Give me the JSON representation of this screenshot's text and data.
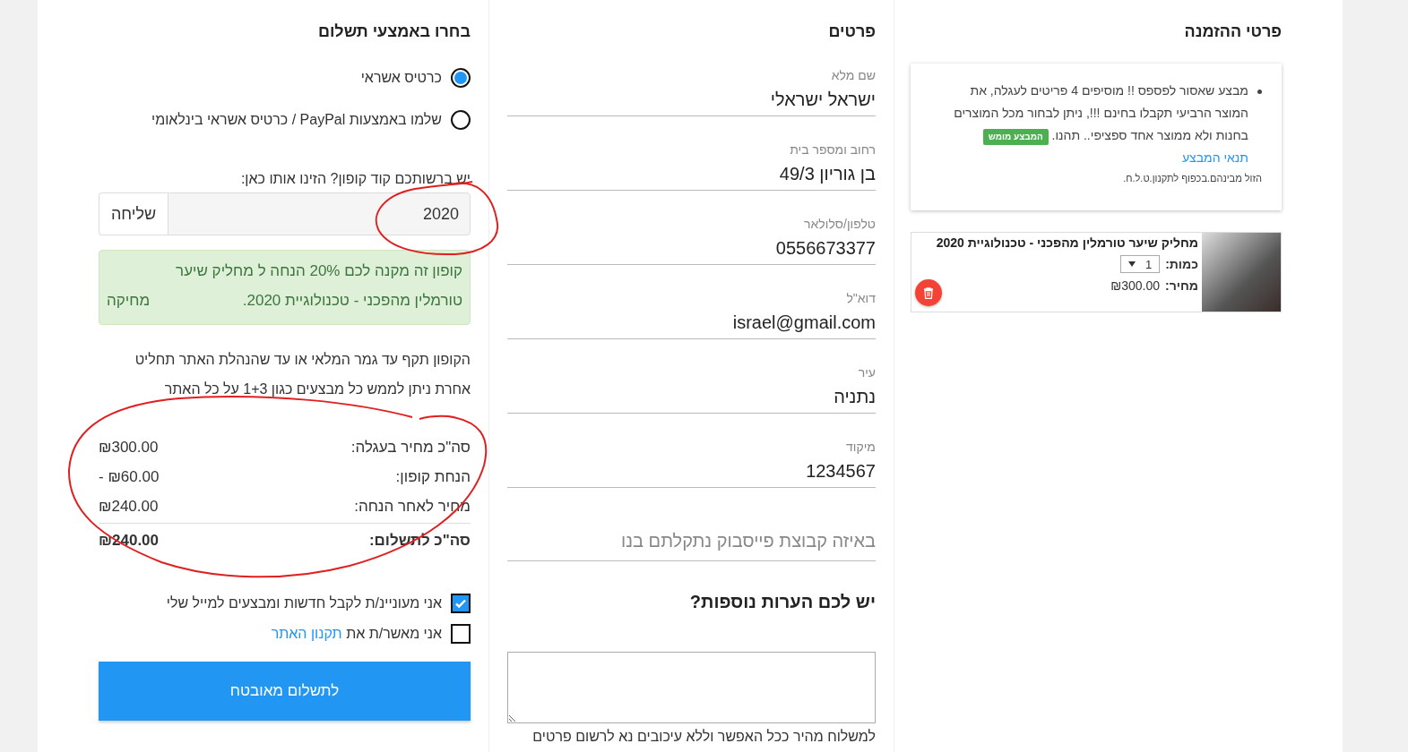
{
  "order_details": {
    "title": "פרטי ההזמנה",
    "promo": {
      "text": "מבצע שאסור לפספס !! מוסיפים 4 פריטים לעגלה, את המוצר הרביעי תקבלו בחינם !!!, ניתן לבחור מכל המוצרים בחנות ולא ממוצר אחד ספציפי.. תהנו.",
      "badge": "המבצע מומש",
      "link": "תנאי המבצע",
      "note": "הזול מבינהם.בכפוף לתקנון.ט.ל.ח."
    },
    "cart_items": [
      {
        "name": "מחליק שיער טורמלין מהפכני - טכנולוגיית 2020",
        "quantity_label": "כמות:",
        "quantity": "1",
        "price_label": "מחיר:",
        "price": "₪300.00"
      }
    ]
  },
  "details": {
    "title": "פרטים",
    "fields": [
      {
        "label": "שם מלא",
        "value": "ישראל ישראלי"
      },
      {
        "label": "רחוב ומספר בית",
        "value": "בן גוריון 49/3"
      },
      {
        "label": "טלפון/סלולאר",
        "value": "0556673377"
      },
      {
        "label": "דוא\"ל",
        "value": "israel@gmail.com"
      },
      {
        "label": "עיר",
        "value": "נתניה"
      },
      {
        "label": "מיקוד",
        "value": "1234567"
      },
      {
        "placeholder": "באיזה קבוצת פייסבוק נתקלתם בנו"
      }
    ],
    "notes_title": "יש לכם הערות נוספות?",
    "notes_hint": "למשלוח מהיר ככל האפשר וללא עיכובים נא לרשום פרטים"
  },
  "payment": {
    "title": "בחרו באמצעי תשלום",
    "methods": [
      {
        "label": "כרטיס אשראי",
        "selected": true
      },
      {
        "label": "שלמו באמצעות PayPal / כרטיס אשראי בינלאומי",
        "selected": false
      }
    ],
    "coupon": {
      "prompt": "יש ברשותכם קוד קופון? הזינו אותו כאן:",
      "value": "2020",
      "button": "שליחה"
    },
    "coupon_alert": {
      "text": "קופון זה מקנה לכם 20% הנחה ל מחליק שיער טורמלין מהפכני - טכנולוגיית 2020.",
      "remove": "מחיקה"
    },
    "coupon_note": "הקופון תקף עד גמר המלאי או עד שהנהלת האתר תחליט אחרת ניתן לממש כל מבצעים כגון 1+3 על כל האתר",
    "totals": [
      {
        "kind": "line",
        "label": "סה\"כ מחיר בעגלה:",
        "value": "₪300.00"
      },
      {
        "kind": "line",
        "label": "הנחת קופון:",
        "value": "- ₪60.00"
      },
      {
        "kind": "line",
        "label": "מחיר לאחר הנחה:",
        "value": "₪240.00"
      },
      {
        "kind": "total",
        "label": "סה\"כ לתשלום:",
        "value": "₪240.00"
      }
    ],
    "checkboxes": [
      {
        "text": "אני מעוניינ/ת לקבל חדשות ומבצעים למייל שלי",
        "checked": true
      },
      {
        "text": "אני מאשר/ת את",
        "link": "תקנון האתר",
        "checked": false
      }
    ],
    "submit": "לתשלום מאובטח"
  }
}
